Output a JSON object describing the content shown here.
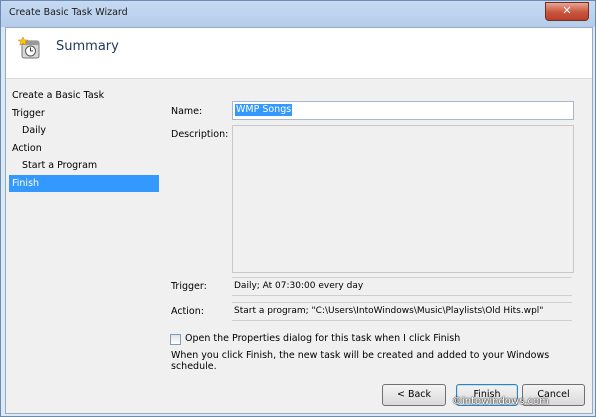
{
  "window": {
    "title": "Create Basic Task Wizard"
  },
  "header": {
    "title": "Summary",
    "icon": "task-scheduler-icon"
  },
  "nav": {
    "items": [
      {
        "label": "Create a Basic Task",
        "level": 0,
        "selected": false
      },
      {
        "label": "Trigger",
        "level": 0,
        "selected": false
      },
      {
        "label": "Daily",
        "level": 1,
        "selected": false
      },
      {
        "label": "Action",
        "level": 0,
        "selected": false
      },
      {
        "label": "Start a Program",
        "level": 1,
        "selected": false
      },
      {
        "label": "Finish",
        "level": 0,
        "selected": true
      }
    ]
  },
  "form": {
    "name_label": "Name:",
    "name_value": "WMP Songs",
    "description_label": "Description:",
    "description_value": "",
    "trigger_label": "Trigger:",
    "trigger_value": "Daily; At 07:30:00 every day",
    "action_label": "Action:",
    "action_value": "Start a program; \"C:\\Users\\IntoWindows\\Music\\Playlists\\Old Hits.wpl\"",
    "checkbox_label": "Open the Properties dialog for this task when I click Finish",
    "checkbox_checked": false,
    "info_text": "When you click Finish, the new task will be created and added to your Windows schedule."
  },
  "buttons": {
    "back": "< Back",
    "finish": "Finish",
    "cancel": "Cancel"
  },
  "watermark": "©intowindows.com",
  "colors": {
    "selection": "#3399ff",
    "title_bar": "#c6daf1",
    "close": "#c8553d"
  }
}
